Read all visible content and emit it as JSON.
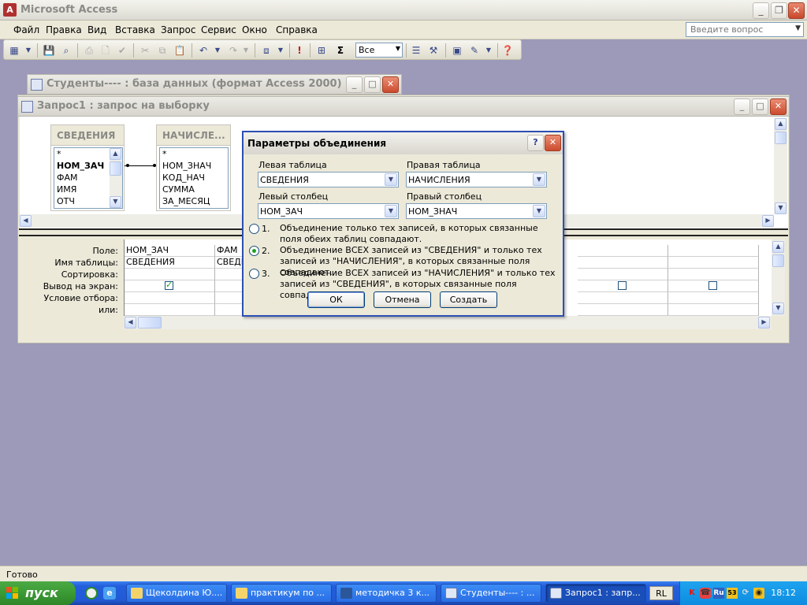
{
  "app": {
    "title": "Microsoft Access"
  },
  "menu": [
    "Файл",
    "Правка",
    "Вид",
    "Вставка",
    "Запрос",
    "Сервис",
    "Окно",
    "Справка"
  ],
  "ask_placeholder": "Введите вопрос",
  "toolbar": {
    "top_values": "Все",
    "sigma": "Σ"
  },
  "db_window": {
    "title": "Студенты---- : база данных (формат Access 2000)"
  },
  "query_window": {
    "title": "Запрос1 : запрос на выборку"
  },
  "tables": [
    {
      "name": "СВЕДЕНИЯ",
      "fields": [
        "*",
        "НОМ_ЗАЧ",
        "ФАМ",
        "ИМЯ",
        "ОТЧ"
      ]
    },
    {
      "name": "НАЧИСЛЕ...",
      "fields": [
        "*",
        "НОМ_ЗНАЧ",
        "КОД_НАЧ",
        "СУММА",
        "ЗА_МЕСЯЦ"
      ]
    }
  ],
  "grid": {
    "row_labels": [
      "Поле:",
      "Имя таблицы:",
      "Сортировка:",
      "Вывод на экран:",
      "Условие отбора:",
      "или:"
    ],
    "columns": [
      {
        "field": "НОМ_ЗАЧ",
        "table": "СВЕДЕНИЯ",
        "show": true
      },
      {
        "field": "ФАМ",
        "table": "СВЕДЕ",
        "show": true
      }
    ]
  },
  "dialog": {
    "title": "Параметры объединения",
    "help": "?",
    "left_table_label": "Левая таблица",
    "left_table_value": "СВЕДЕНИЯ",
    "right_table_label": "Правая таблица",
    "right_table_value": "НАЧИСЛЕНИЯ",
    "left_column_label": "Левый столбец",
    "left_column_value": "НОМ_ЗАЧ",
    "right_column_label": "Правый столбец",
    "right_column_value": "НОМ_ЗНАЧ",
    "options": [
      {
        "num": "1.",
        "text": "Объединение только тех записей, в которых связанные поля обеих таблиц совпадают.",
        "selected": false
      },
      {
        "num": "2.",
        "text": "Объединение ВСЕХ записей из \"СВЕДЕНИЯ\" и только тех записей из \"НАЧИСЛЕНИЯ\", в которых связанные поля совпадают.",
        "selected": true
      },
      {
        "num": "3.",
        "text": "Объединение ВСЕХ записей из \"НАЧИСЛЕНИЯ\" и только тех записей из \"СВЕДЕНИЯ\", в которых связанные поля совпадают.",
        "selected": false
      }
    ],
    "ok": "ОК",
    "cancel": "Отмена",
    "create": "Создать"
  },
  "status": "Готово",
  "taskbar": {
    "start": "пуск",
    "tasks": [
      "Щеколдина Ю....",
      "практикум по ...",
      "методичка 3 к...",
      "Студенты---- : ...",
      "Запрос1 : запр..."
    ],
    "lang": "RL",
    "clock": "18:12"
  }
}
